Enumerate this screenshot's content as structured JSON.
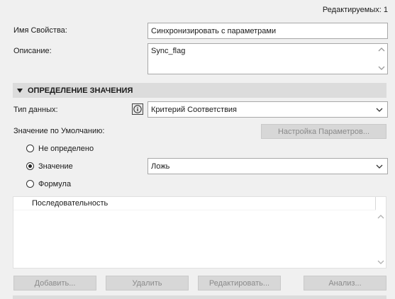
{
  "header": {
    "editable_count": "Редактируемых: 1"
  },
  "property": {
    "name_label": "Имя Свойства:",
    "name_value": "Синхронизировать с параметрами",
    "description_label": "Описание:",
    "description_value": "Sync_flag"
  },
  "value_section": {
    "title": "ОПРЕДЕЛЕНИЕ ЗНАЧЕНИЯ",
    "data_type_label": "Тип данных:",
    "data_type_value": "Критерий Соответствия",
    "default_label": "Значение по Умолчанию:",
    "param_settings_button": "Настройка Параметров...",
    "radios": [
      {
        "label": "Не определено",
        "selected": false
      },
      {
        "label": "Значение",
        "selected": true
      },
      {
        "label": "Формула",
        "selected": false
      }
    ],
    "value_select": "Ложь"
  },
  "sequence_list": {
    "header": "Последовательность"
  },
  "buttons": {
    "add": "Добавить...",
    "delete": "Удалить",
    "edit": "Редактировать...",
    "analyze": "Анализ..."
  },
  "colors": {
    "background": "#f0f0f0",
    "section_bg": "#dcdcdc",
    "disabled_text": "#8a8a8a"
  }
}
